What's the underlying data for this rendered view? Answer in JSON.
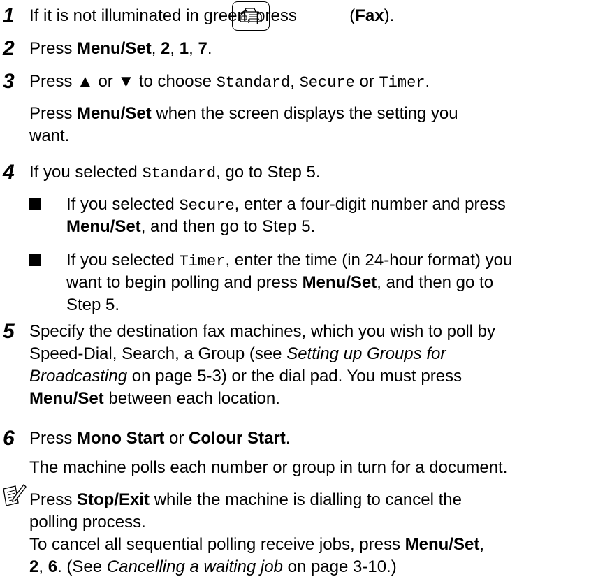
{
  "steps": [
    {
      "number": "1",
      "lines": [
        {
          "parts": [
            {
              "t": "If it is not illuminated in green, press ",
              "s": "normal"
            },
            {
              "t": " (",
              "s": "normal"
            },
            {
              "t": "Fax",
              "s": "bold"
            },
            {
              "t": ").",
              "s": "normal"
            }
          ]
        }
      ]
    },
    {
      "number": "2",
      "lines": [
        {
          "parts": [
            {
              "t": "Press ",
              "s": "normal"
            },
            {
              "t": "Menu/Set",
              "s": "bold"
            },
            {
              "t": ", ",
              "s": "normal"
            },
            {
              "t": "2",
              "s": "bold"
            },
            {
              "t": ", ",
              "s": "normal"
            },
            {
              "t": "1",
              "s": "bold"
            },
            {
              "t": ", ",
              "s": "normal"
            },
            {
              "t": "7",
              "s": "bold"
            },
            {
              "t": ".",
              "s": "normal"
            }
          ]
        }
      ]
    },
    {
      "number": "3",
      "lines": [
        {
          "parts": [
            {
              "t": "Press ▲ or ▼ to choose ",
              "s": "normal"
            },
            {
              "t": "Standard",
              "s": "mono"
            },
            {
              "t": ", ",
              "s": "normal"
            },
            {
              "t": "Secure",
              "s": "mono"
            },
            {
              "t": " or ",
              "s": "normal"
            },
            {
              "t": "Timer",
              "s": "mono"
            },
            {
              "t": ".",
              "s": "normal"
            }
          ]
        },
        {
          "parts": [
            {
              "t": "Press ",
              "s": "normal"
            },
            {
              "t": "Menu/Set",
              "s": "bold"
            },
            {
              "t": " when the screen displays the setting you",
              "s": "normal"
            }
          ]
        },
        {
          "parts": [
            {
              "t": "want.",
              "s": "normal"
            }
          ]
        }
      ]
    },
    {
      "number": "4",
      "lines": [
        {
          "parts": [
            {
              "t": "If you selected ",
              "s": "normal"
            },
            {
              "t": "Standard",
              "s": "mono"
            },
            {
              "t": ", go to Step 5.",
              "s": "normal"
            }
          ]
        }
      ]
    },
    {
      "number": "5",
      "lines": [
        {
          "parts": [
            {
              "t": "Specify the destination fax machines, which you wish to poll by",
              "s": "normal"
            }
          ]
        },
        {
          "parts": [
            {
              "t": "Speed-Dial, Search, a Group (see ",
              "s": "normal"
            },
            {
              "t": "Setting up Groups for",
              "s": "italic"
            }
          ]
        },
        {
          "parts": [
            {
              "t": "Broadcasting",
              "s": "italic"
            },
            {
              "t": " on page 5-3) or the dial pad. You must press",
              "s": "normal"
            }
          ]
        },
        {
          "parts": [
            {
              "t": "Menu/Set",
              "s": "bold"
            },
            {
              "t": " between each location.",
              "s": "normal"
            }
          ]
        }
      ]
    },
    {
      "number": "6",
      "lines": [
        {
          "parts": [
            {
              "t": "Press ",
              "s": "normal"
            },
            {
              "t": "Mono Start",
              "s": "bold"
            },
            {
              "t": " or ",
              "s": "normal"
            },
            {
              "t": "Colour Start",
              "s": "bold"
            },
            {
              "t": ".",
              "s": "normal"
            }
          ]
        },
        {
          "parts": [
            {
              "t": "The machine polls each number or group in turn for a document.",
              "s": "normal"
            }
          ]
        }
      ]
    }
  ],
  "sub_bullets": [
    {
      "lines": [
        {
          "parts": [
            {
              "t": "If you selected ",
              "s": "normal"
            },
            {
              "t": "Secure",
              "s": "mono"
            },
            {
              "t": ", enter a four-digit number and press",
              "s": "normal"
            }
          ]
        },
        {
          "parts": [
            {
              "t": "Menu/Set",
              "s": "bold"
            },
            {
              "t": ", and then go to Step 5.",
              "s": "normal"
            }
          ]
        }
      ]
    },
    {
      "lines": [
        {
          "parts": [
            {
              "t": "If you selected ",
              "s": "normal"
            },
            {
              "t": "Timer",
              "s": "mono"
            },
            {
              "t": ", enter the time (in 24-hour format) you",
              "s": "normal"
            }
          ]
        },
        {
          "parts": [
            {
              "t": "want to begin polling and press ",
              "s": "normal"
            },
            {
              "t": "Menu/Set",
              "s": "bold"
            },
            {
              "t": ", and then go to",
              "s": "normal"
            }
          ]
        },
        {
          "parts": [
            {
              "t": "Step 5.",
              "s": "normal"
            }
          ]
        }
      ]
    }
  ],
  "note": {
    "icon": "note-pencil-icon",
    "lines": [
      {
        "parts": [
          {
            "t": "Press ",
            "s": "normal"
          },
          {
            "t": "Stop/Exit",
            "s": "bold"
          },
          {
            "t": " while the machine is dialling to cancel the",
            "s": "normal"
          }
        ]
      },
      {
        "parts": [
          {
            "t": "polling process.",
            "s": "normal"
          }
        ]
      },
      {
        "parts": [
          {
            "t": "To cancel all sequential polling receive jobs, press ",
            "s": "normal"
          },
          {
            "t": "Menu/Set",
            "s": "bold"
          },
          {
            "t": ",",
            "s": "normal"
          }
        ]
      },
      {
        "parts": [
          {
            "t": "2",
            "s": "bold"
          },
          {
            "t": ", ",
            "s": "normal"
          },
          {
            "t": "6",
            "s": "bold"
          },
          {
            "t": ". (See ",
            "s": "normal"
          },
          {
            "t": "Cancelling a waiting job",
            "s": "italic"
          },
          {
            "t": " on page 3-10.)",
            "s": "normal"
          }
        ]
      }
    ]
  },
  "icons": {
    "fax_button": "fax-machine-icon",
    "bullet": "square-bullet-icon"
  }
}
